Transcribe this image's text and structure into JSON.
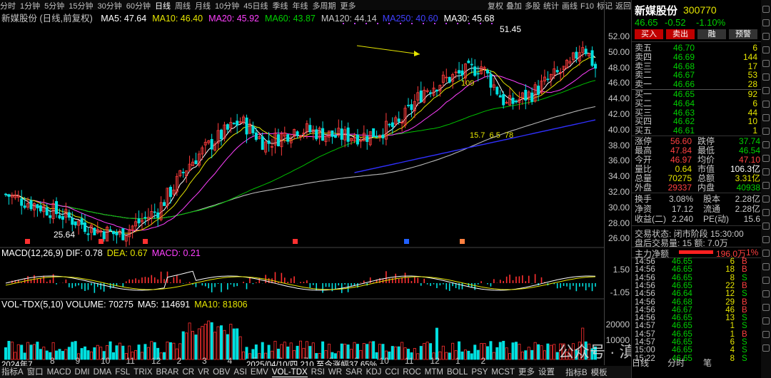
{
  "toolbar": {
    "tabs": [
      "分时",
      "1分钟",
      "5分钟",
      "15分钟",
      "30分钟",
      "60分钟",
      "日线",
      "周线",
      "月线",
      "10分钟",
      "45日线",
      "季线",
      "年线",
      "多周期",
      "更多"
    ],
    "active": "日线",
    "right_tools": [
      "复权",
      "叠加",
      "多股",
      "统计",
      "画线",
      "F10",
      "标记",
      "返回"
    ]
  },
  "chart_title": "新媒股份 (日线,前复权)",
  "ma_legend": [
    {
      "label": "MA5: 47.64",
      "color": "#ffffff"
    },
    {
      "label": "MA10: 46.40",
      "color": "#e6e600"
    },
    {
      "label": "MA20: 45.92",
      "color": "#ff40ff"
    },
    {
      "label": "MA60: 43.87",
      "color": "#00d000"
    },
    {
      "label": "MA120: 44.14",
      "color": "#c8c8c8"
    },
    {
      "label": "MA250: 40.60",
      "color": "#4040ff"
    },
    {
      "label": "MA30: 45.68",
      "color": "#ffffff"
    }
  ],
  "annotations": {
    "high": "51.45",
    "low": "25.64",
    "mid_label": "109",
    "stats": "15.7  6.5  78",
    "date_label": "2025/04/10/四 210 至今涨幅37.65%",
    "year_label": "2024年7"
  },
  "price_axis": [
    "52.00",
    "50.00",
    "48.00",
    "46.00",
    "44.00",
    "42.00",
    "40.00",
    "38.00",
    "36.00",
    "34.00",
    "32.00",
    "30.00",
    "28.00",
    "26.00"
  ],
  "x_months": [
    "8",
    "9",
    "10",
    "11",
    "12",
    "2",
    "3",
    "4",
    "5",
    "6",
    "7",
    "8",
    "9",
    "10",
    "11",
    "12",
    "1",
    "2"
  ],
  "macd": {
    "legend": [
      {
        "label": "MACD(12,26,9) DIF: 0.78",
        "color": "#ffffff"
      },
      {
        "label": "DEA: 0.67",
        "color": "#e6e600"
      },
      {
        "label": "MACD: 0.21",
        "color": "#ff40ff"
      }
    ],
    "axis": [
      "1.50",
      "-1.05"
    ]
  },
  "volume": {
    "legend": [
      {
        "label": "VOL-TDX(5,10) VOLUME: 70275",
        "color": "#ffffff"
      },
      {
        "label": "MA5: 114691",
        "color": "#ffffff"
      },
      {
        "label": "MA10: 81806",
        "color": "#e6e600"
      }
    ],
    "axis": [
      "20000",
      "10000"
    ]
  },
  "bottom_tabs": [
    "指标A",
    "窗口",
    "MACD",
    "DMI",
    "DMA",
    "FSL",
    "TRIX",
    "BRAR",
    "CR",
    "VR",
    "OBV",
    "ASI",
    "EMV",
    "VOL-TDX",
    "RSI",
    "WR",
    "SAR",
    "KDJ",
    "CCI",
    "ROC",
    "MTM",
    "BOLL",
    "PSY",
    "MCST",
    "更多",
    "设置"
  ],
  "bottom_tab_active": "VOL-TDX",
  "bottom_right": [
    "指标B",
    "模板"
  ],
  "watermark": "公众号 · 滇南子",
  "quote": {
    "name": "新媒股份",
    "code": "300770",
    "price": "46.65",
    "change": "-0.52",
    "pct": "-1.10%",
    "buttons": [
      "买入",
      "卖出",
      "融",
      "预警"
    ],
    "asks": [
      {
        "label": "卖五",
        "price": "46.70",
        "vol": "6"
      },
      {
        "label": "卖四",
        "price": "46.69",
        "vol": "144"
      },
      {
        "label": "卖三",
        "price": "46.68",
        "vol": "17"
      },
      {
        "label": "卖二",
        "price": "46.67",
        "vol": "53"
      },
      {
        "label": "卖一",
        "price": "46.66",
        "vol": "28"
      }
    ],
    "bids": [
      {
        "label": "买一",
        "price": "46.65",
        "vol": "92"
      },
      {
        "label": "买二",
        "price": "46.64",
        "vol": "6"
      },
      {
        "label": "买三",
        "price": "46.63",
        "vol": "44"
      },
      {
        "label": "买四",
        "price": "46.62",
        "vol": "10"
      },
      {
        "label": "买五",
        "price": "46.61",
        "vol": "1"
      }
    ],
    "stats": [
      {
        "k1": "涨停",
        "v1": "56.60",
        "c1": "up",
        "k2": "跌停",
        "v2": "37.74",
        "c2": "dn"
      },
      {
        "k1": "最高",
        "v1": "47.84",
        "c1": "up",
        "k2": "最低",
        "v2": "46.54",
        "c2": "dn"
      },
      {
        "k1": "今开",
        "v1": "46.97",
        "c1": "up",
        "k2": "均价",
        "v2": "47.10",
        "c2": "up"
      },
      {
        "k1": "量比",
        "v1": "0.64",
        "c1": "y",
        "k2": "市值",
        "v2": "106.3亿",
        "c2": "w"
      },
      {
        "k1": "总量",
        "v1": "70275",
        "c1": "y",
        "k2": "总额",
        "v2": "3.31亿",
        "c2": "y"
      },
      {
        "k1": "外盘",
        "v1": "29337",
        "c1": "up",
        "k2": "内盘",
        "v2": "40938",
        "c2": "dn"
      }
    ],
    "stats2": [
      {
        "k1": "换手",
        "v1": "3.08%",
        "k2": "股本",
        "v2": "2.28亿"
      },
      {
        "k1": "净资",
        "v1": "17.12",
        "k2": "流通",
        "v2": "2.28亿"
      },
      {
        "k1": "收益(二)",
        "v1": "2.240",
        "k2": "PE(动)",
        "v2": "15.6"
      }
    ],
    "status": "交易状态: 闭市阶段 15:30:00",
    "after": "盘后交易量: 15  额: 7.0万",
    "flow_label": "主力净额",
    "flow_value": "196.0万",
    "flow_pct": "1%",
    "ticks": [
      {
        "t": "14:56",
        "p": "46.65",
        "v": "6",
        "s": "B"
      },
      {
        "t": "14:56",
        "p": "46.65",
        "v": "18",
        "s": "B"
      },
      {
        "t": "14:56",
        "p": "46.65",
        "v": "8",
        "s": "S"
      },
      {
        "t": "14:56",
        "p": "46.65",
        "v": "22",
        "s": "B"
      },
      {
        "t": "14:56",
        "p": "46.64",
        "v": "12",
        "s": "S"
      },
      {
        "t": "14:56",
        "p": "46.68",
        "v": "29",
        "s": "B"
      },
      {
        "t": "14:56",
        "p": "46.67",
        "v": "46",
        "s": "B"
      },
      {
        "t": "14:56",
        "p": "46.65",
        "v": "13",
        "s": "S"
      },
      {
        "t": "14:57",
        "p": "46.65",
        "v": "1",
        "s": "S"
      },
      {
        "t": "14:57",
        "p": "46.65",
        "v": "1",
        "s": "B"
      },
      {
        "t": "14:57",
        "p": "46.65",
        "v": "6",
        "s": "S"
      },
      {
        "t": "15:00",
        "p": "46.65",
        "v": "4",
        "s": "S"
      },
      {
        "t": "15:22",
        "p": "46.65",
        "v": "8",
        "s": "S"
      }
    ],
    "side_tabs": [
      "日线",
      "分时",
      "笔"
    ]
  }
}
